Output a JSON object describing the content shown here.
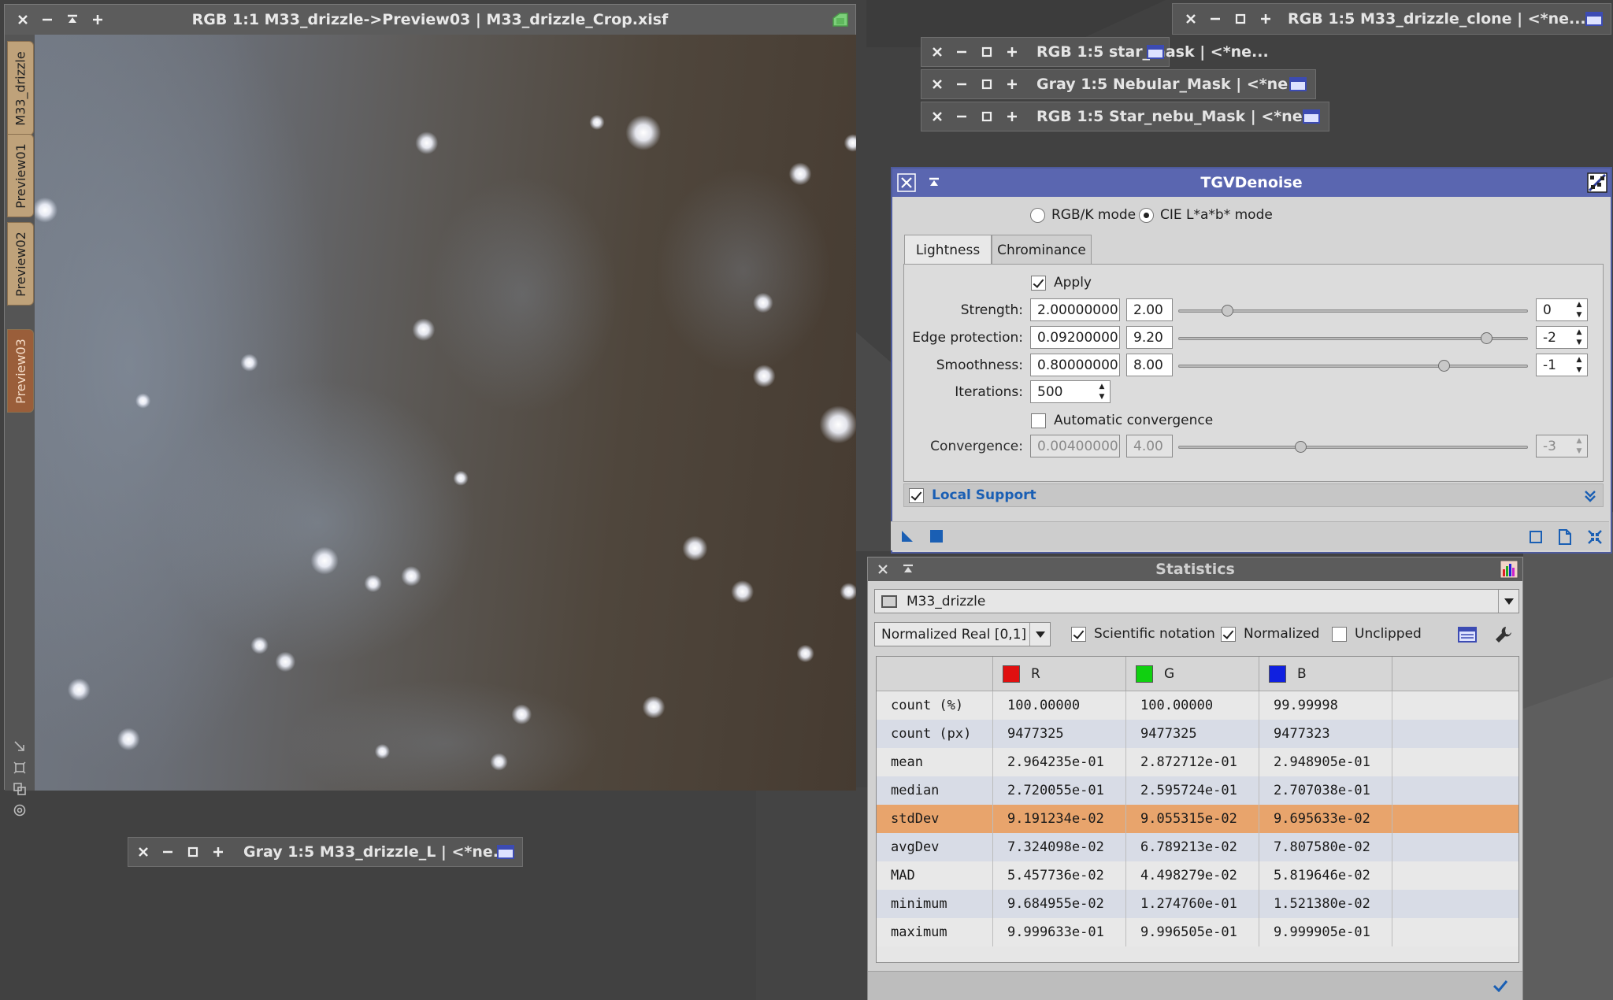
{
  "main_window": {
    "title": "RGB 1:1 M33_drizzle->Preview03 | M33_drizzle_Crop.xisf",
    "view_tabs": [
      "M33_drizzle",
      "Preview01",
      "Preview02",
      "Preview03"
    ],
    "active_view": "Preview03"
  },
  "minimized_windows": [
    {
      "title": "RGB 1:5 M33_drizzle_clone | <*ne..."
    },
    {
      "title": "RGB 1:5 star_mask | <*ne..."
    },
    {
      "title": "Gray 1:5 Nebular_Mask | <*ne..."
    },
    {
      "title": "RGB 1:5 Star_nebu_Mask | <*ne..."
    },
    {
      "title": "Gray 1:5 M33_drizzle_L | <*ne..."
    }
  ],
  "tgv": {
    "title": "TGVDenoise",
    "mode_options": [
      "RGB/K mode",
      "CIE L*a*b* mode"
    ],
    "selected_mode": "CIE L*a*b* mode",
    "tabs": [
      "Lightness",
      "Chrominance"
    ],
    "active_tab": "Lightness",
    "apply_label": "Apply",
    "apply_checked": true,
    "strength": {
      "label": "Strength:",
      "value": "2.00000000",
      "short": "2.00",
      "exp": "0",
      "slider_fraction": 0.14
    },
    "edge": {
      "label": "Edge protection:",
      "value": "0.09200000",
      "short": "9.20",
      "exp": "-2",
      "slider_fraction": 0.88
    },
    "smooth": {
      "label": "Smoothness:",
      "value": "0.80000000",
      "short": "8.00",
      "exp": "-1",
      "slider_fraction": 0.76
    },
    "iterations": {
      "label": "Iterations:",
      "value": "500"
    },
    "auto_conv_label": "Automatic convergence",
    "auto_conv_checked": false,
    "convergence": {
      "label": "Convergence:",
      "value": "0.00400000",
      "short": "4.00",
      "exp": "-3",
      "slider_fraction": 0.35
    },
    "local_support_label": "Local Support",
    "local_support_checked": true
  },
  "stats": {
    "title": "Statistics",
    "view": "M33_drizzle",
    "range": "Normalized Real [0,1]",
    "scientific_label": "Scientific notation",
    "scientific_checked": true,
    "normalized_label": "Normalized",
    "normalized_checked": true,
    "unclipped_label": "Unclipped",
    "unclipped_checked": false,
    "channels": [
      {
        "name": "R",
        "color": "#e01010"
      },
      {
        "name": "G",
        "color": "#10d010"
      },
      {
        "name": "B",
        "color": "#1020e0"
      }
    ],
    "rows": [
      {
        "label": "count (%)",
        "r": "100.00000",
        "g": "100.00000",
        "b": "99.99998"
      },
      {
        "label": "count (px)",
        "r": "9477325",
        "g": "9477325",
        "b": "9477323"
      },
      {
        "label": "mean",
        "r": "2.964235e-01",
        "g": "2.872712e-01",
        "b": "2.948905e-01"
      },
      {
        "label": "median",
        "r": "2.720055e-01",
        "g": "2.595724e-01",
        "b": "2.707038e-01"
      },
      {
        "label": "stdDev",
        "r": "9.191234e-02",
        "g": "9.055315e-02",
        "b": "9.695633e-02"
      },
      {
        "label": "avgDev",
        "r": "7.324098e-02",
        "g": "6.789213e-02",
        "b": "7.807580e-02"
      },
      {
        "label": "MAD",
        "r": "5.457736e-02",
        "g": "4.498279e-02",
        "b": "5.819646e-02"
      },
      {
        "label": "minimum",
        "r": "9.684955e-02",
        "g": "1.274760e-01",
        "b": "1.521380e-02"
      },
      {
        "label": "maximum",
        "r": "9.999633e-01",
        "g": "9.996505e-01",
        "b": "9.999905e-01"
      }
    ],
    "selected_row": "stdDev"
  },
  "colors": {
    "tgv_titlebar": "#5a66b0",
    "selected_row": "#e8a46c",
    "accent_blue": "#1a5fb4",
    "desktop": "#414141"
  }
}
